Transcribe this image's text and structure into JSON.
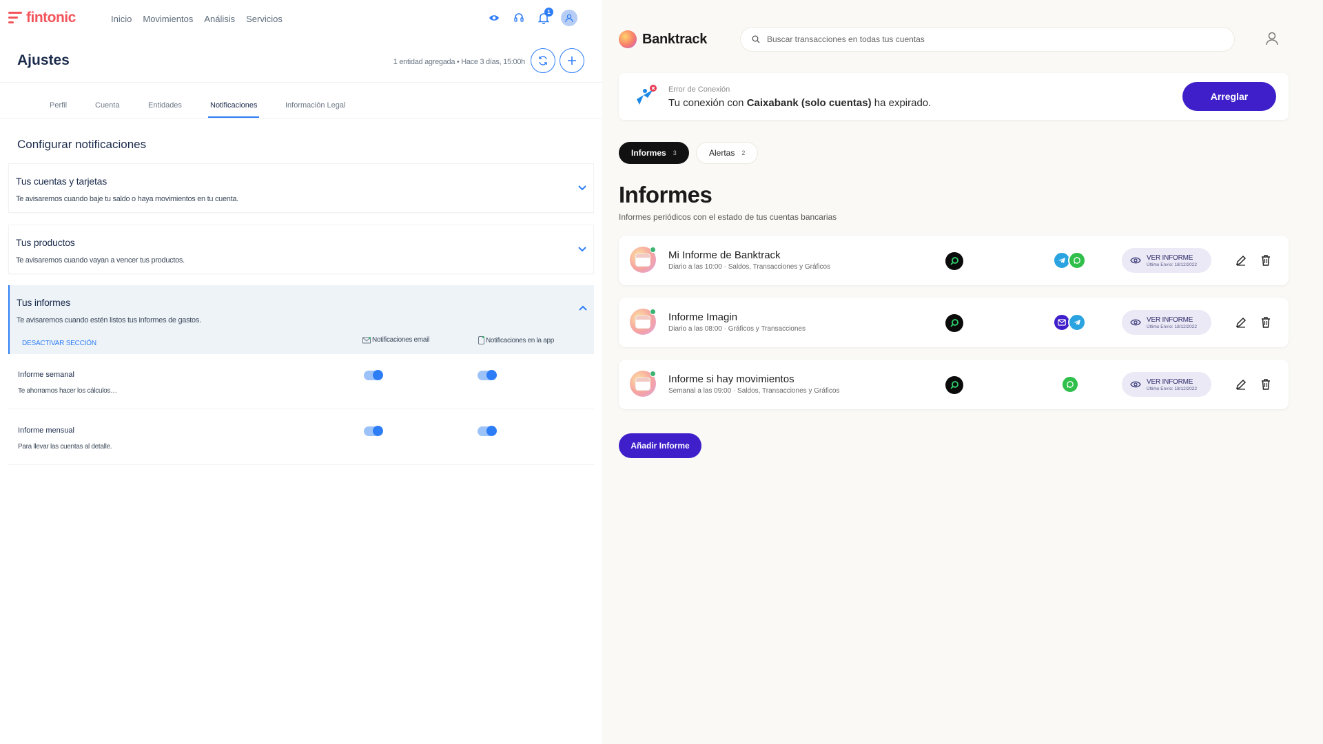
{
  "fintonic": {
    "logo": "fintonic",
    "nav": [
      "Inicio",
      "Movimientos",
      "Análisis",
      "Servicios"
    ],
    "notification_count": "1",
    "page_title": "Ajustes",
    "meta": "1 entidad agregada • Hace 3 días, 15:00h",
    "tabs": [
      "Perfil",
      "Cuenta",
      "Entidades",
      "Notificaciones",
      "Información Legal"
    ],
    "active_tab": "Notificaciones",
    "section_title": "Configurar notificaciones",
    "sections": [
      {
        "title": "Tus cuentas y tarjetas",
        "desc": "Te avisaremos cuando baje tu saldo o haya movimientos en tu cuenta."
      },
      {
        "title": "Tus productos",
        "desc": "Te avisaremos cuando vayan a vencer tus productos."
      },
      {
        "title": "Tus informes",
        "desc": "Te avisaremos cuando estén listos tus informes de gastos."
      }
    ],
    "deactivate": "DESACTIVAR SECCIÓN",
    "col_email": "Notificaciones email",
    "col_app": "Notificaciones en la app",
    "rows": [
      {
        "title": "Informe semanal",
        "desc": "Te ahorramos hacer los cálculos…",
        "email_on": true,
        "app_on": true
      },
      {
        "title": "Informe mensual",
        "desc": "Para llevar las cuentas al detalle.",
        "email_on": true,
        "app_on": true
      }
    ],
    "colors": {
      "brand": "#f2545b",
      "accent": "#2d7df6"
    }
  },
  "banktrack": {
    "logo": "Banktrack",
    "search_placeholder": "Buscar transacciones en todas tus cuentas",
    "error": {
      "label": "Error de Conexión",
      "text_before": "Tu conexión con ",
      "bank": "Caixabank (solo cuentas)",
      "text_after": " ha expirado.",
      "fix_button": "Arreglar"
    },
    "pills": [
      {
        "label": "Informes",
        "count": "3"
      },
      {
        "label": "Alertas",
        "count": "2"
      }
    ],
    "heading": "Informes",
    "subheading": "Informes periódicos con el estado de tus cuentas bancarias",
    "view_label": "VER INFORME",
    "view_date": "Último Envío: 18/12/2022",
    "reports": [
      {
        "name": "Mi Informe de Banktrack",
        "desc": "Diario a las 10:00 · Saldos, Transacciones y Gráficos",
        "channels": [
          "telegram-icon",
          "whatsapp-icon"
        ]
      },
      {
        "name": "Informe Imagin",
        "desc": "Diario a las 08:00 · Gráficos y Transacciones",
        "channels": [
          "email-icon",
          "telegram-icon"
        ]
      },
      {
        "name": "Informe si hay movimientos",
        "desc": "Semanal a las 09:00 · Saldos, Transacciones y Gráficos",
        "channels": [
          "whatsapp-icon"
        ]
      }
    ],
    "add_button": "Añadir Informe",
    "colors": {
      "primary": "#3f1fc9",
      "telegram": "#2aa3e0",
      "whatsapp": "#2fbf4a"
    }
  }
}
